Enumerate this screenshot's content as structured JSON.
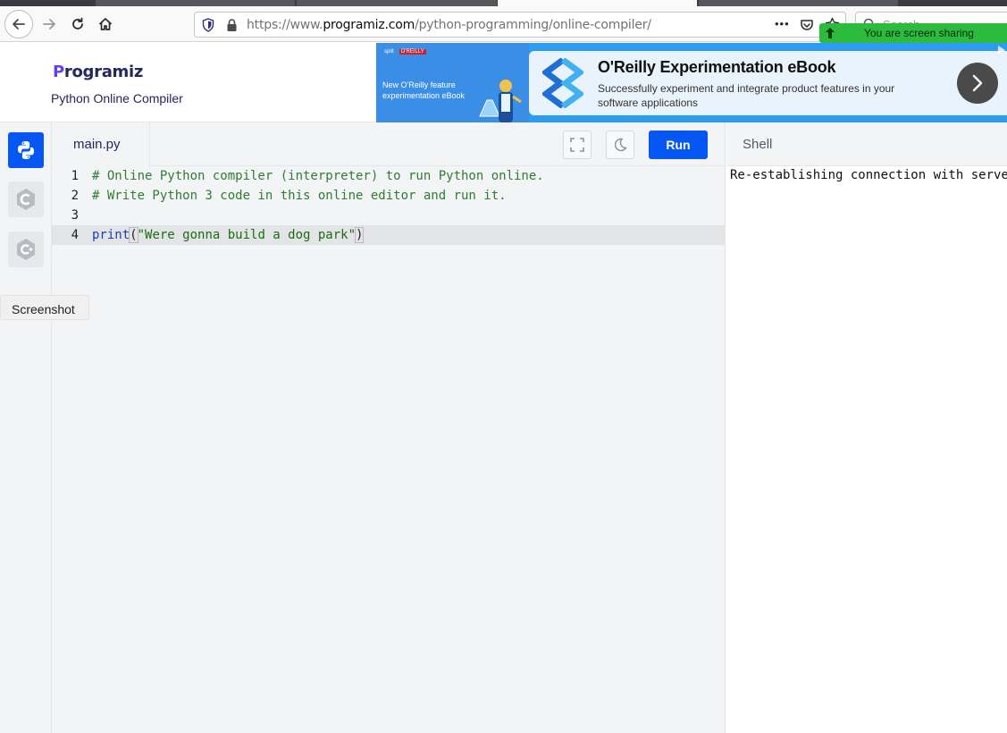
{
  "browser": {
    "url_prefix": "https://www.",
    "url_domain": "programiz.com",
    "url_path": "/python-programming/online-compiler/",
    "search_placeholder": "Search",
    "more_label": "•••",
    "screen_sharing_text": "You are screen sharing"
  },
  "site": {
    "logo_text": "rogramiz",
    "logo_letter": "P",
    "subtitle": "Python Online Compiler"
  },
  "ad": {
    "brand_left": "split",
    "brand_right": "O'REILLY",
    "left_text": "New O'Reilly feature experimentation eBook",
    "title": "O'Reilly Experimentation eBook",
    "description": "Successfully experiment and integrate product features in your software applications"
  },
  "sidebar": {
    "languages": [
      {
        "name": "python",
        "active": true
      },
      {
        "name": "c",
        "active": false
      },
      {
        "name": "cpp",
        "active": false
      }
    ]
  },
  "tooltip": "Screenshot",
  "editor": {
    "filename": "main.py",
    "run_label": "Run",
    "lines": [
      {
        "num": "1",
        "text": "# Online Python compiler (interpreter) to run Python online."
      },
      {
        "num": "2",
        "text": "# Write Python 3 code in this online editor and run it."
      },
      {
        "num": "3",
        "text": ""
      },
      {
        "num": "4",
        "keyword": "print",
        "open": "(",
        "string": "\"Were gonna build a dog park\"",
        "close": ")"
      }
    ]
  },
  "shell": {
    "title": "Shell",
    "output": "Re-establishing connection with serve"
  },
  "colors": {
    "accent": "#0556f3",
    "share_green": "#2cbb3c",
    "ad_blue": "#2c9cf0"
  }
}
